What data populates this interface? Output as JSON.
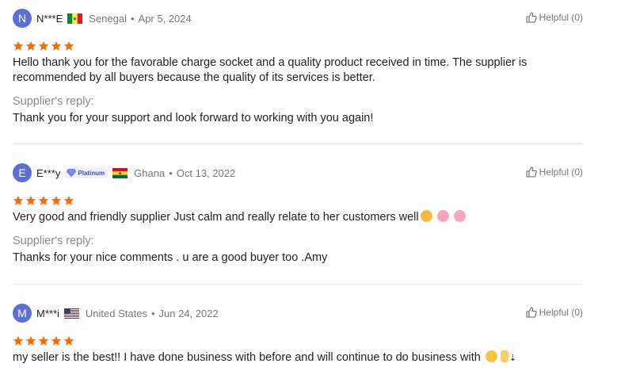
{
  "reviews": [
    {
      "initial": "N",
      "name": "N***E",
      "country": "Senegal",
      "date": "Apr 5, 2024",
      "helpful": "Helpful (0)",
      "text": "Hello thank you for the favorable charge socket and a quality product received in time. The supplier is recommended by all buyers because the quality of its services is better.",
      "reply_label": "Supplier's reply:",
      "reply_text": "Thank you for your support and look forward to working with you again!"
    },
    {
      "initial": "E",
      "name": "E***y",
      "badge": "Platinum",
      "country": "Ghana",
      "date": "Oct 13, 2022",
      "helpful": "Helpful (0)",
      "text": "Very good and friendly supplier Just calm and really relate to her customers well",
      "reply_label": "Supplier's reply:",
      "reply_text": "Thanks for your nice comments . u are a good buyer too .Amy"
    },
    {
      "initial": "M",
      "name": "M***i",
      "country": "United States",
      "date": "Jun 24, 2022",
      "helpful": "Helpful (0)",
      "text": "my seller is the best!! I have done business with before and will continue to do business with"
    }
  ],
  "colors": {
    "star": "#ff6a00",
    "avatar": "#5b6fd6"
  },
  "rating": 5
}
